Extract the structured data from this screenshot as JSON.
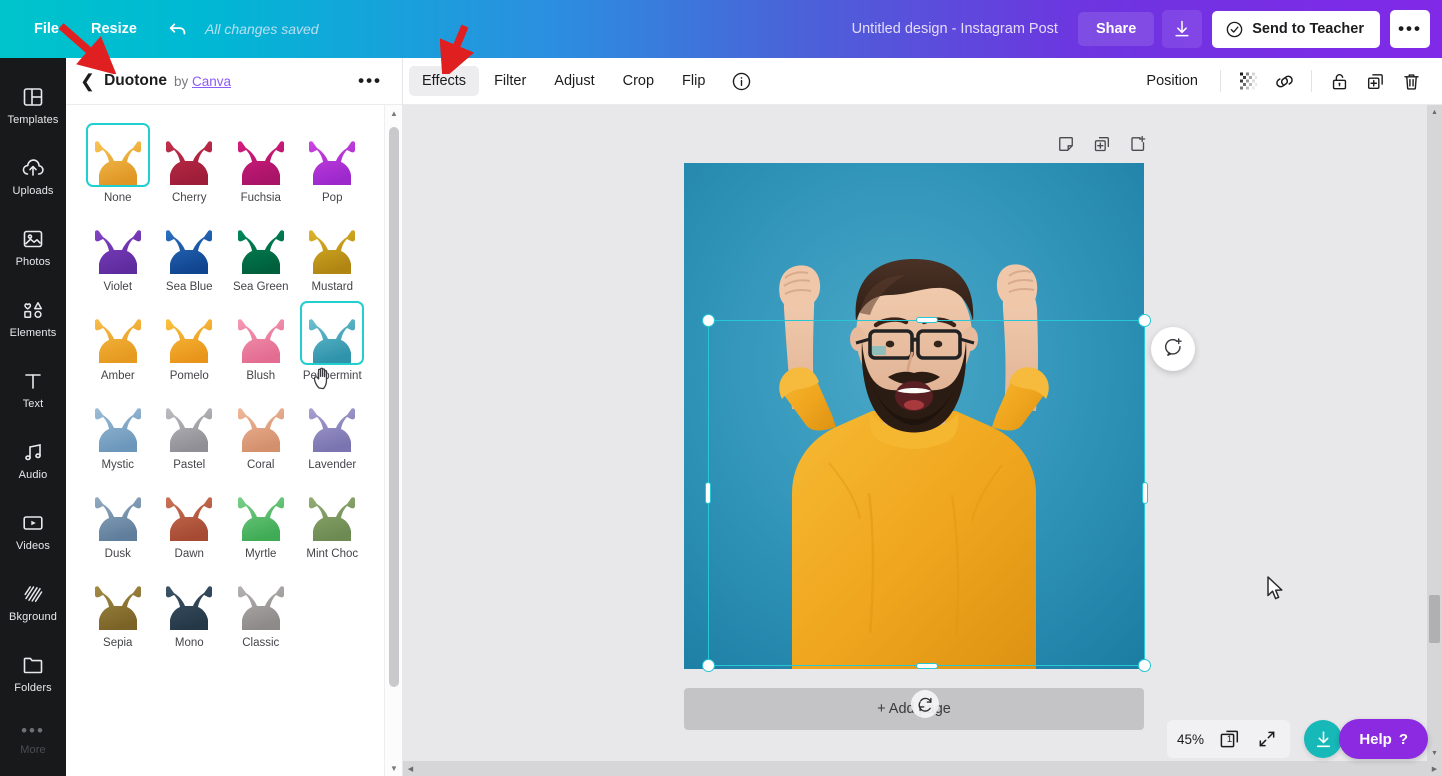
{
  "topbar": {
    "file_label": "File",
    "resize_label": "Resize",
    "undo_icon": "undo-arrow-icon",
    "saved_status": "All changes saved",
    "design_title": "Untitled design - Instagram Post",
    "share_label": "Share",
    "download_icon": "download-icon",
    "send_to_teacher_label": "Send to Teacher",
    "send_icon": "check-circle-icon",
    "more_label": "•••",
    "gradient_start": "#00c4cc",
    "gradient_end": "#8129e8"
  },
  "rail": {
    "items": [
      {
        "label": "Templates",
        "icon": "templates-icon"
      },
      {
        "label": "Uploads",
        "icon": "upload-cloud-icon"
      },
      {
        "label": "Photos",
        "icon": "photo-icon"
      },
      {
        "label": "Elements",
        "icon": "shapes-icon"
      },
      {
        "label": "Text",
        "icon": "text-icon"
      },
      {
        "label": "Audio",
        "icon": "music-note-icon"
      },
      {
        "label": "Videos",
        "icon": "video-icon"
      },
      {
        "label": "Bkground",
        "icon": "hatch-pattern-icon"
      },
      {
        "label": "Folders",
        "icon": "folder-icon"
      },
      {
        "label": "More",
        "icon": "ellipsis-icon"
      }
    ]
  },
  "panel": {
    "back_icon": "chevron-left-icon",
    "title": "Duotone",
    "by_text": "by",
    "author": "Canva",
    "more_label": "•••",
    "swatches": [
      {
        "name": "None",
        "dark": "#e09726",
        "light": "#f8c555",
        "selected": true
      },
      {
        "name": "Cherry",
        "dark": "#9e1d38",
        "light": "#c4304c",
        "selected": false
      },
      {
        "name": "Fuchsia",
        "dark": "#a81468",
        "light": "#d61d7f",
        "selected": false
      },
      {
        "name": "Pop",
        "dark": "#9c28cc",
        "light": "#cc45e0",
        "selected": false
      },
      {
        "name": "Violet",
        "dark": "#5f2c9e",
        "light": "#8243c4",
        "selected": false
      },
      {
        "name": "Sea Blue",
        "dark": "#11458f",
        "light": "#2b71c4",
        "selected": false
      },
      {
        "name": "Sea Green",
        "dark": "#00603c",
        "light": "#00895b",
        "selected": false
      },
      {
        "name": "Mustard",
        "dark": "#b08512",
        "light": "#ddb429",
        "selected": false
      },
      {
        "name": "Amber",
        "dark": "#e69a1f",
        "light": "#f7bd4b",
        "selected": false
      },
      {
        "name": "Pomelo",
        "dark": "#e9951c",
        "light": "#fbc23f",
        "selected": false
      },
      {
        "name": "Blush",
        "dark": "#e36d92",
        "light": "#f59ab4",
        "selected": false
      },
      {
        "name": "Peppermint",
        "dark": "#2e93ab",
        "light": "#6cc0d0",
        "selected": true
      },
      {
        "name": "Mystic",
        "dark": "#6c97bb",
        "light": "#9dbdd6",
        "selected": false
      },
      {
        "name": "Pastel",
        "dark": "#8f8f95",
        "light": "#bdbdc2",
        "selected": false
      },
      {
        "name": "Coral",
        "dark": "#d4906d",
        "light": "#efb99b",
        "selected": false
      },
      {
        "name": "Lavender",
        "dark": "#7a74b0",
        "light": "#a7a2d0",
        "selected": false
      },
      {
        "name": "Dusk",
        "dark": "#5f7e9c",
        "light": "#93abc1",
        "selected": false
      },
      {
        "name": "Dawn",
        "dark": "#a64a33",
        "light": "#cb7356",
        "selected": false
      },
      {
        "name": "Myrtle",
        "dark": "#3fab55",
        "light": "#7ad089",
        "selected": false
      },
      {
        "name": "Mint Choc",
        "dark": "#6c8a52",
        "light": "#93ad73",
        "selected": false
      },
      {
        "name": "Sepia",
        "dark": "#7b6327",
        "light": "#a38c45",
        "selected": false
      },
      {
        "name": "Mono",
        "dark": "#253848",
        "light": "#3d5468",
        "selected": false
      },
      {
        "name": "Classic",
        "dark": "#8e8a8a",
        "light": "#b6b2b2",
        "selected": false
      }
    ]
  },
  "editor_toolbar": {
    "tabs": [
      {
        "label": "Effects",
        "active": true
      },
      {
        "label": "Filter",
        "active": false
      },
      {
        "label": "Adjust",
        "active": false
      },
      {
        "label": "Crop",
        "active": false
      },
      {
        "label": "Flip",
        "active": false
      }
    ],
    "info_icon": "info-circle-icon",
    "position_label": "Position",
    "icons": [
      {
        "name": "transparency-icon"
      },
      {
        "name": "link-icon"
      },
      {
        "name": "lock-icon"
      },
      {
        "name": "duplicate-icon"
      },
      {
        "name": "trash-icon"
      }
    ]
  },
  "canvas": {
    "page_icons": [
      {
        "name": "notes-icon"
      },
      {
        "name": "duplicate-page-icon"
      },
      {
        "name": "add-page-icon"
      }
    ],
    "comment_icon": "add-comment-icon",
    "rotate_icon": "rotate-handle-icon",
    "add_page_label": "+ Add page",
    "photo_alt": "bearded-man-celebrating-yellow-sweater",
    "photo_bg": "#2c8fb5",
    "sweater_color": "#f0a61e",
    "selection_color": "#28c7d6"
  },
  "bottom_bar": {
    "zoom_level": "45%",
    "page_number": "1",
    "page_count_icon": "page-stack-icon",
    "fullscreen_icon": "expand-icon",
    "download_icon": "download-circle-icon",
    "help_label": "Help",
    "help_suffix": "?",
    "help_color": "#8b2ae0",
    "download_color": "#17b8b8"
  },
  "annotations": {
    "arrow_color": "#e02020",
    "arrow_1_target": "duotone-panel-header",
    "arrow_2_target": "effects-tab"
  }
}
